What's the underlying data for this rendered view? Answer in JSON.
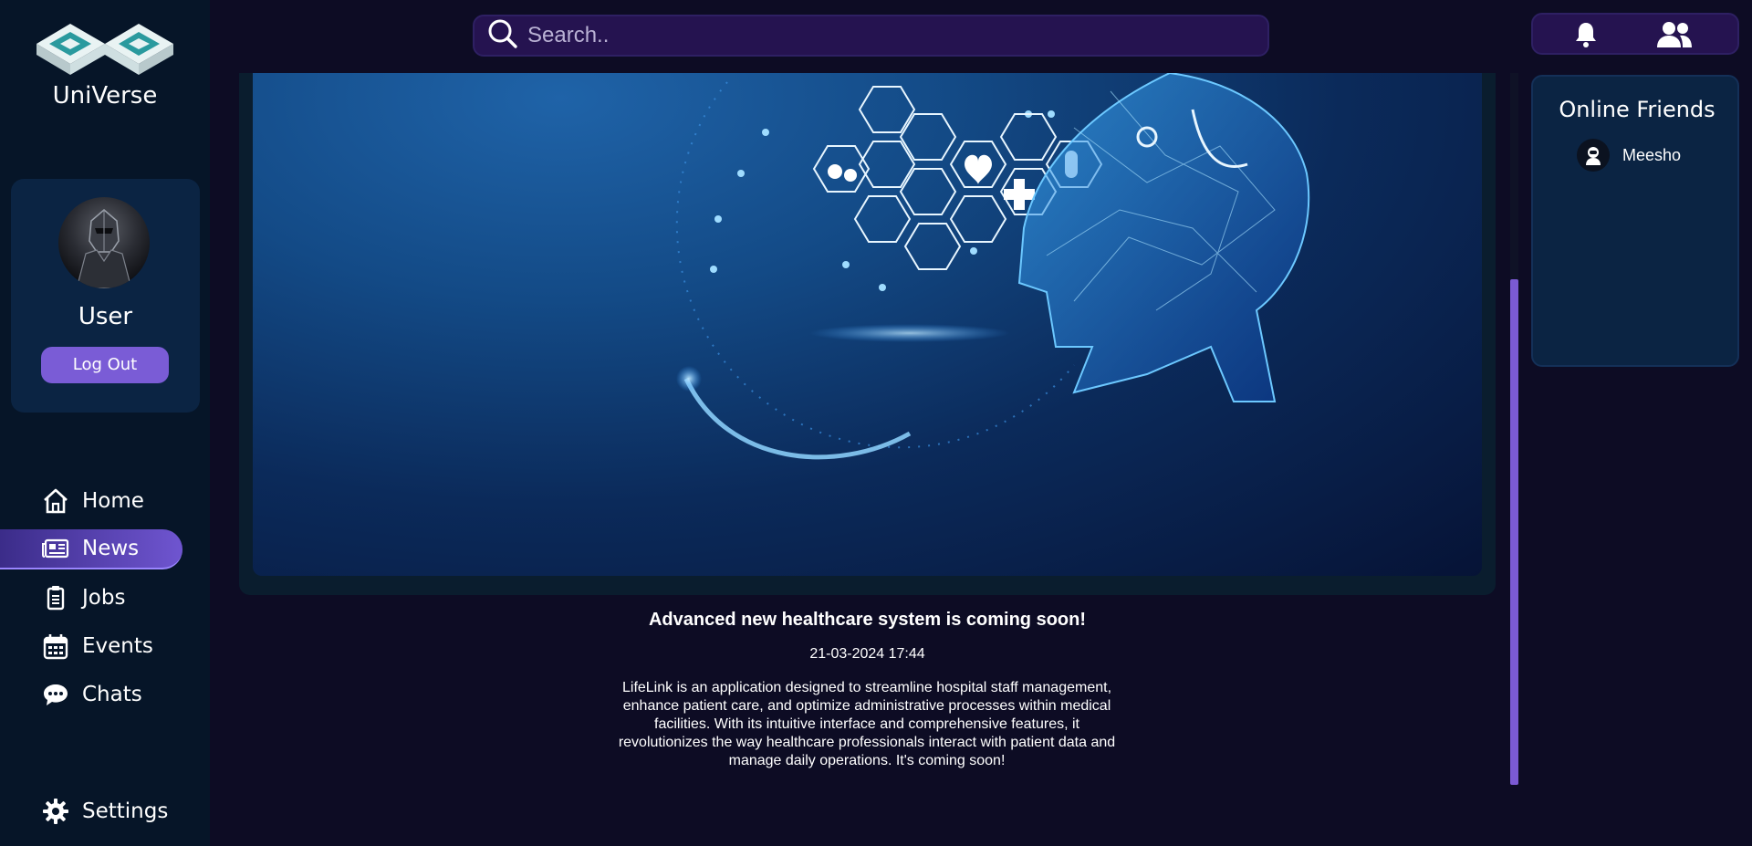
{
  "app": {
    "brand": "UniVerse",
    "accent_color": "#7a5cd6",
    "sidebar_bg": "#061528",
    "page_bg": "#0d0c24"
  },
  "user": {
    "name": "User",
    "logout_label": "Log Out"
  },
  "nav": {
    "items": [
      {
        "label": "Home",
        "icon": "home-icon",
        "active": false
      },
      {
        "label": "News",
        "icon": "newspaper-icon",
        "active": true
      },
      {
        "label": "Jobs",
        "icon": "clipboard-icon",
        "active": false
      },
      {
        "label": "Events",
        "icon": "calendar-icon",
        "active": false
      },
      {
        "label": "Chats",
        "icon": "chat-bubble-icon",
        "active": false
      }
    ],
    "settings_label": "Settings"
  },
  "search": {
    "placeholder": "Search.."
  },
  "article": {
    "title": "Advanced new healthcare system is coming soon!",
    "date": "21-03-2024 17:44",
    "body_lines": [
      "LifeLink is an application designed to streamline hospital staff management,",
      "enhance patient care, and optimize administrative processes within medical",
      "facilities. With its intuitive interface and comprehensive features, it",
      "revolutionizes the way healthcare professionals interact with patient data and",
      "manage daily operations. It's coming soon!"
    ]
  },
  "friends": {
    "title": "Online Friends",
    "list": [
      {
        "name": "Meesho"
      }
    ]
  },
  "scroll": {
    "position_fraction": 0.29,
    "visible_fraction": 0.71
  }
}
